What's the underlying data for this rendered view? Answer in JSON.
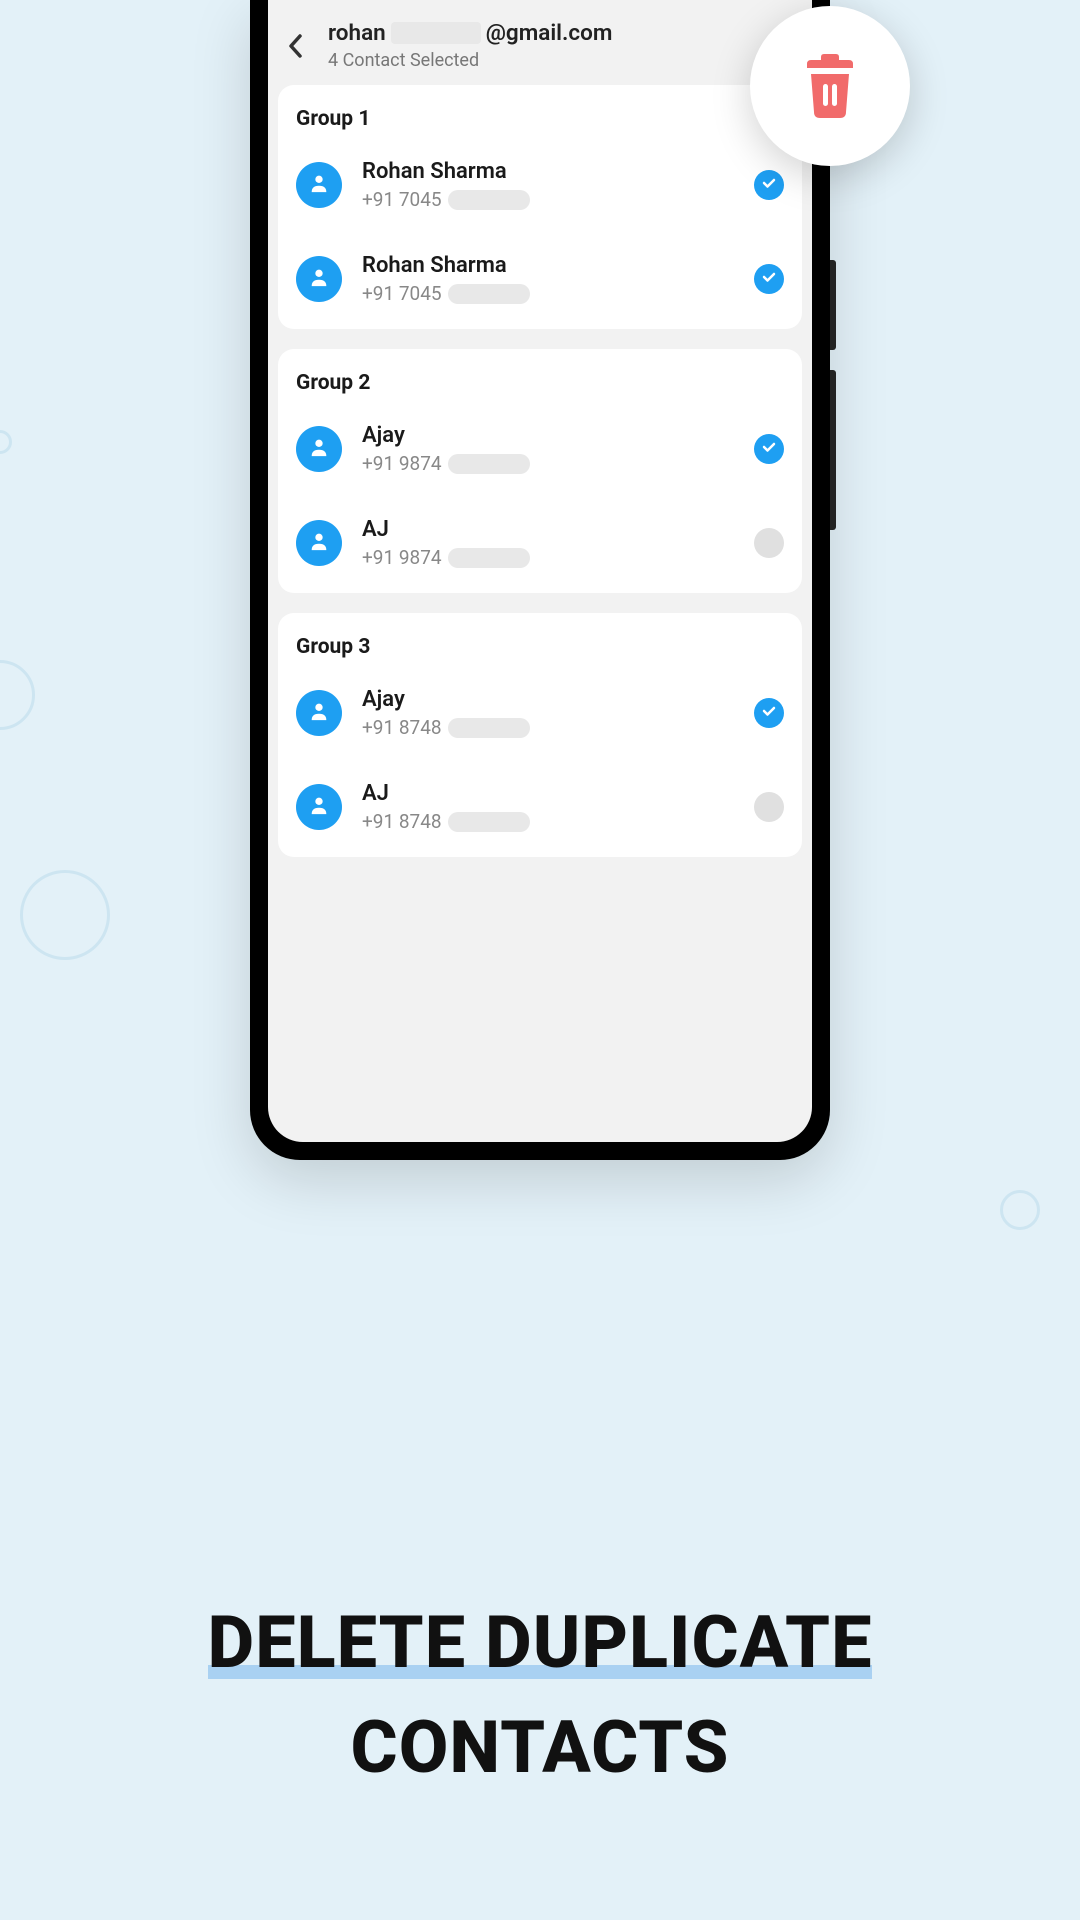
{
  "header": {
    "title_prefix": "rohan",
    "title_suffix": "@gmail.com",
    "subtitle": "4 Contact Selected"
  },
  "groups": [
    {
      "title": "Group 1",
      "contacts": [
        {
          "name": "Rohan Sharma",
          "phone_prefix": "+91 7045",
          "selected": true
        },
        {
          "name": "Rohan Sharma",
          "phone_prefix": "+91 7045",
          "selected": true
        }
      ]
    },
    {
      "title": "Group 2",
      "contacts": [
        {
          "name": "Ajay",
          "phone_prefix": "+91 9874",
          "selected": true
        },
        {
          "name": "AJ",
          "phone_prefix": "+91 9874",
          "selected": false
        }
      ]
    },
    {
      "title": "Group 3",
      "contacts": [
        {
          "name": "Ajay",
          "phone_prefix": "+91 8748",
          "selected": true
        },
        {
          "name": "AJ",
          "phone_prefix": "+91 8748",
          "selected": false
        }
      ]
    }
  ],
  "promo": {
    "line1": "DELETE DUPLICATE",
    "line2": "CONTACTS"
  },
  "colors": {
    "accent": "#1E9FF2",
    "danger": "#F16B6B",
    "bg": "#E3F1F8"
  }
}
